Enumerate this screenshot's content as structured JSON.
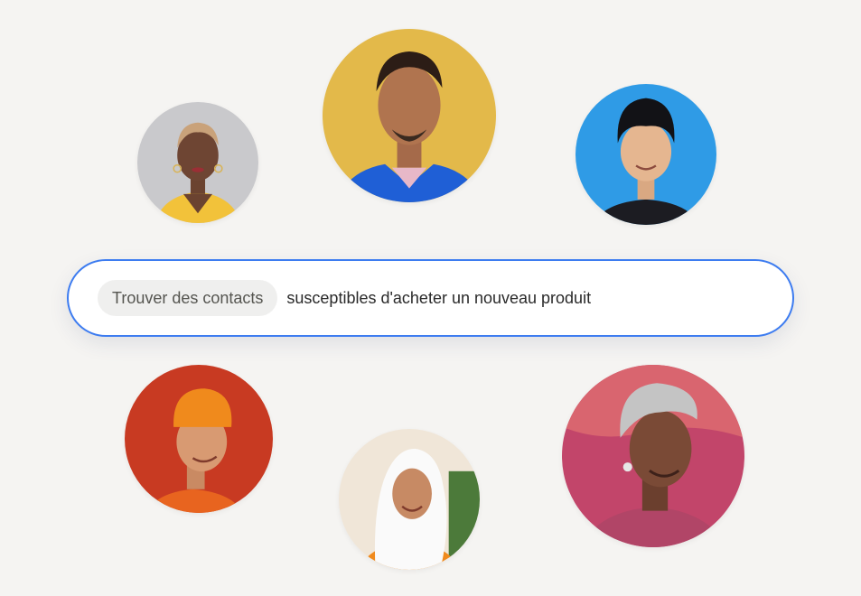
{
  "search": {
    "chip_label": "Trouver des contacts",
    "query": "susceptibles d'acheter un nouveau produit"
  },
  "colors": {
    "page_background": "#f5f4f2",
    "search_border": "#3d7cf0",
    "chip_background": "#efefee"
  },
  "avatars": [
    {
      "name": "contact-avatar-gray-background",
      "background": "#c9c9cc"
    },
    {
      "name": "contact-avatar-yellow-background",
      "background": "#e3b94a"
    },
    {
      "name": "contact-avatar-blue-background",
      "background": "#2f9be6"
    },
    {
      "name": "contact-avatar-red-background",
      "background": "#c83a22"
    },
    {
      "name": "contact-avatar-light-background",
      "background": "#f0e6d8"
    },
    {
      "name": "contact-avatar-pink-background",
      "background": "#c2456a"
    }
  ]
}
